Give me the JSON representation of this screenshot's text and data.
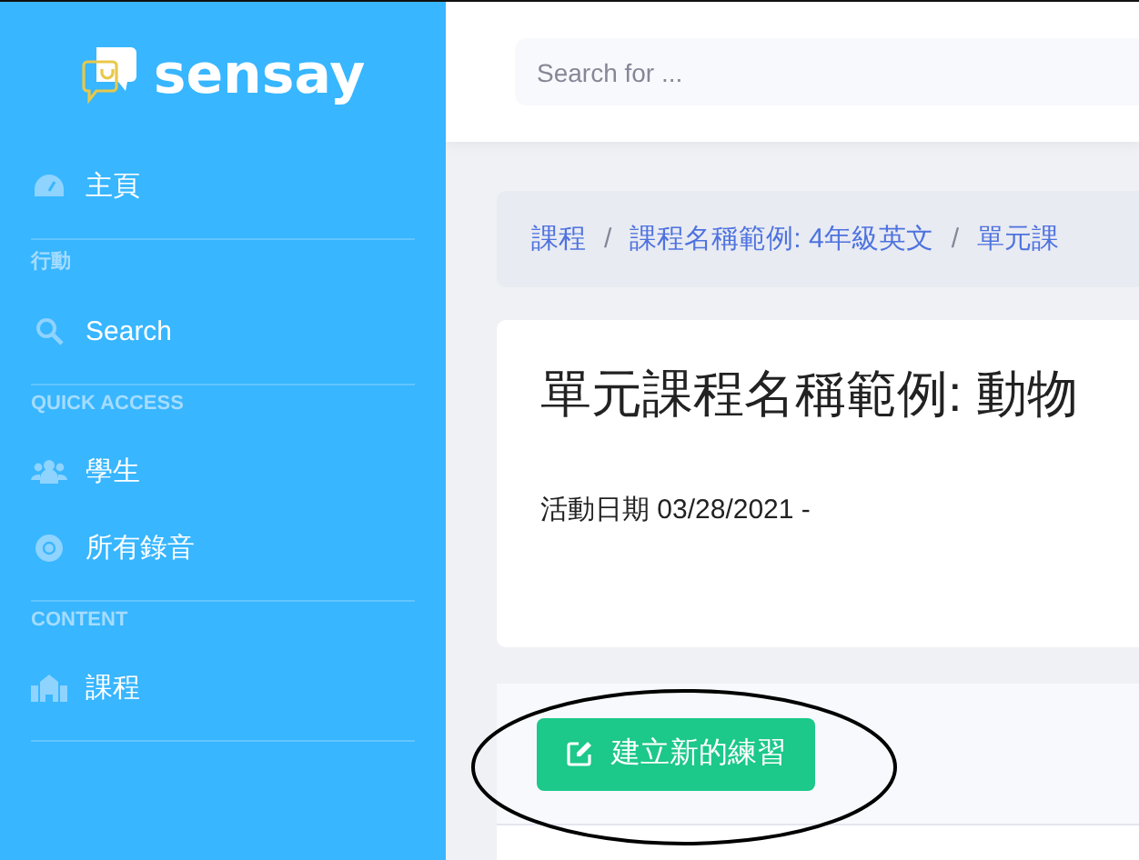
{
  "sidebar": {
    "logo": "sensay",
    "groups": [
      {
        "items": [
          {
            "label": "主頁"
          }
        ]
      },
      {
        "heading": "行動",
        "items": [
          {
            "label": "Search"
          }
        ]
      },
      {
        "heading": "QUICK ACCESS",
        "items": [
          {
            "label": "學生"
          },
          {
            "label": "所有錄音"
          }
        ]
      },
      {
        "heading": "CONTENT",
        "items": [
          {
            "label": "課程"
          }
        ]
      }
    ]
  },
  "topbar": {
    "search": {
      "placeholder": "Search for ..."
    }
  },
  "breadcrumb": {
    "separator": "/",
    "items": [
      "課程",
      "課程名稱範例: 4年級英文",
      "單元課"
    ]
  },
  "card": {
    "title": "單元課程名稱範例: 動物",
    "date": "活動日期 03/28/2021 -"
  },
  "actions": {
    "button": "建立新的練習"
  }
}
